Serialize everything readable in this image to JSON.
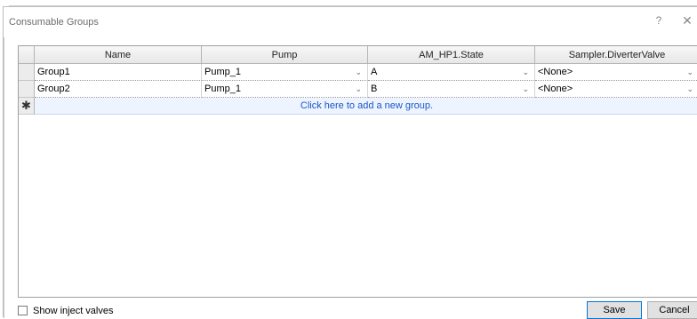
{
  "dialog": {
    "title": "Consumable Groups",
    "help_label": "?",
    "close_label": "✕"
  },
  "grid": {
    "columns": [
      "Name",
      "Pump",
      "AM_HP1.State",
      "Sampler.DiverterValve"
    ],
    "rows": [
      [
        "Group1",
        "Pump_1",
        "A",
        "<None>"
      ],
      [
        "Group2",
        "Pump_1",
        "B",
        "<None>"
      ]
    ],
    "dropdown_glyph": "⌄",
    "new_row_marker": "✱",
    "new_row_text": "Click here to add a new group."
  },
  "footer": {
    "show_inject_label": "Show inject valves",
    "show_inject_checked": false,
    "save_label": "Save",
    "cancel_label": "Cancel"
  },
  "colors": {
    "link": "#1a56c7",
    "new_row_bg": "#eef4ff",
    "default_button_border": "#0078d7"
  }
}
